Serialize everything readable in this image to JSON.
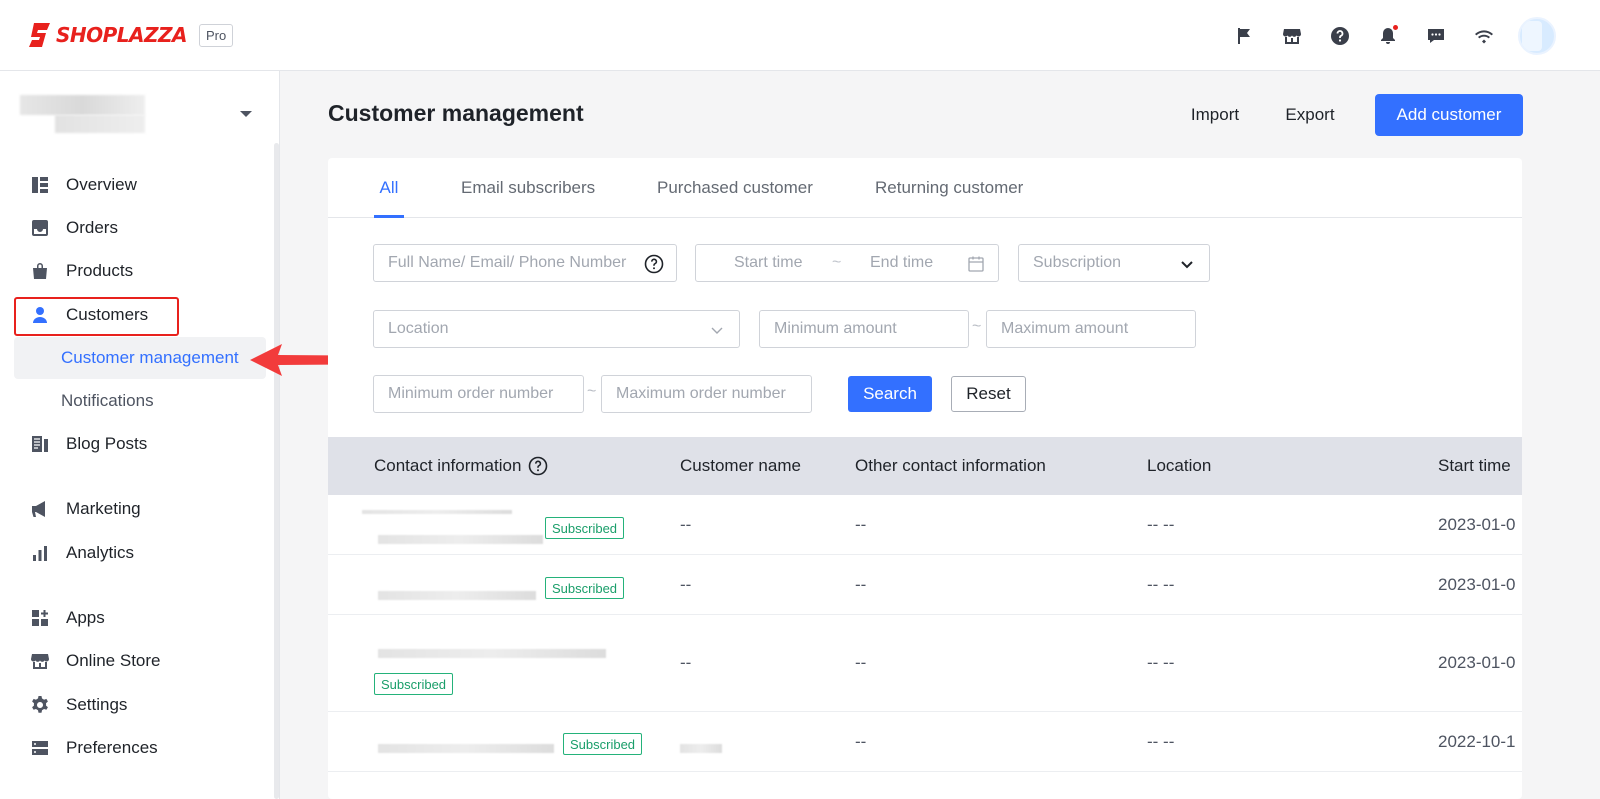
{
  "app": {
    "brand": "SHOPLAZZA",
    "plan_badge": "Pro",
    "accent_color": "#3370ff",
    "brand_color": "#e8211d"
  },
  "top_icons": [
    "flag-icon",
    "store-icon",
    "help-icon",
    "bell-icon",
    "chat-icon",
    "wifi-icon"
  ],
  "sidebar": {
    "items": [
      {
        "label": "Overview",
        "icon": "overview-icon"
      },
      {
        "label": "Orders",
        "icon": "orders-icon"
      },
      {
        "label": "Products",
        "icon": "products-icon"
      },
      {
        "label": "Customers",
        "icon": "customers-icon"
      },
      {
        "label": "Customer management"
      },
      {
        "label": "Notifications"
      },
      {
        "label": "Blog Posts",
        "icon": "blog-icon"
      },
      {
        "label": "Marketing",
        "icon": "megaphone-icon"
      },
      {
        "label": "Analytics",
        "icon": "chart-icon"
      },
      {
        "label": "Apps",
        "icon": "apps-icon"
      },
      {
        "label": "Online Store",
        "icon": "online-store-icon"
      },
      {
        "label": "Settings",
        "icon": "gear-icon"
      },
      {
        "label": "Preferences",
        "icon": "preferences-icon"
      }
    ]
  },
  "header": {
    "title": "Customer management",
    "import_label": "Import",
    "export_label": "Export",
    "add_label": "Add customer"
  },
  "tabs": [
    "All",
    "Email subscribers",
    "Purchased customer",
    "Returning customer"
  ],
  "filters": {
    "search_placeholder": "Full Name/ Email/ Phone Number",
    "start_time": "Start time",
    "end_time": "End time",
    "range_sep": "~",
    "subscription": "Subscription",
    "location": "Location",
    "min_amount": "Minimum amount",
    "max_amount": "Maximum amount",
    "min_orders": "Minimum order number",
    "max_orders": "Maximum order number",
    "search_label": "Search",
    "reset_label": "Reset"
  },
  "table": {
    "columns": [
      "Contact information",
      "Customer name",
      "Other contact information",
      "Location",
      "Start time"
    ],
    "tag_label": "Subscribed",
    "rows": [
      {
        "name": "--",
        "other": "--",
        "location": "-- --",
        "start": "2023-01-0"
      },
      {
        "name": "--",
        "other": "--",
        "location": "-- --",
        "start": "2023-01-0"
      },
      {
        "name": "--",
        "other": "--",
        "location": "-- --",
        "start": "2023-01-0"
      },
      {
        "name": "",
        "other": "--",
        "location": "-- --",
        "start": "2022-10-1"
      }
    ]
  }
}
